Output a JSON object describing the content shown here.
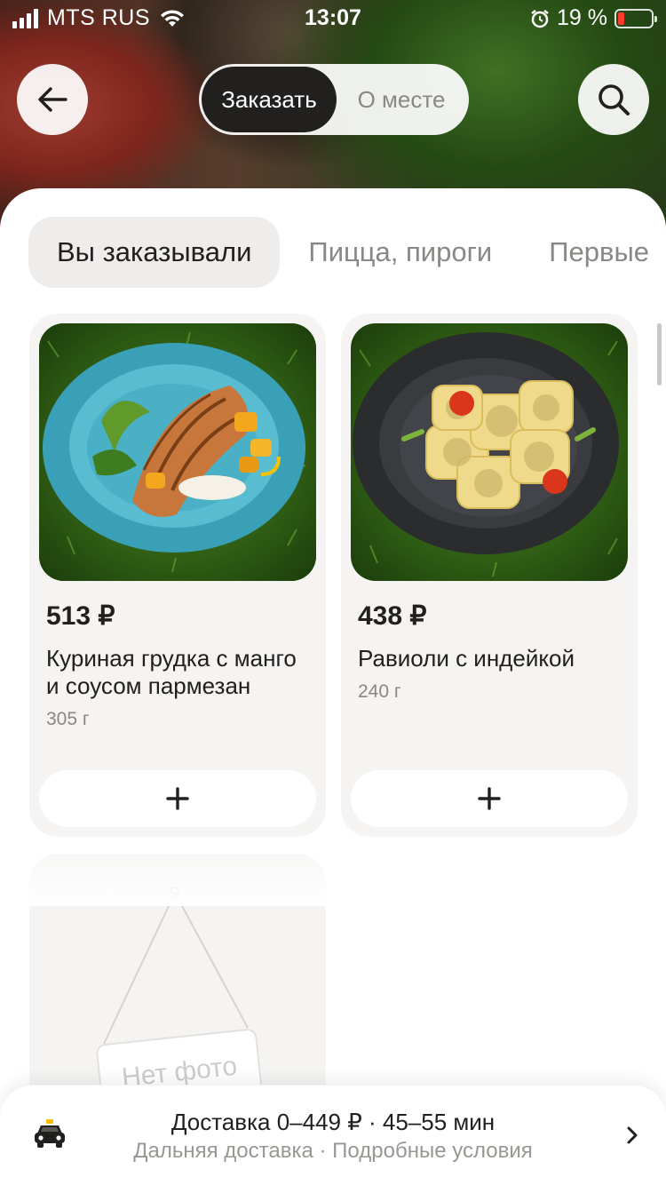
{
  "status_bar": {
    "carrier": "MTS RUS",
    "time": "13:07",
    "battery_percent": "19 %",
    "battery_level": 0.19
  },
  "nav": {
    "back_icon": "arrow-left-icon",
    "search_icon": "search-icon",
    "segments": [
      {
        "label": "Заказать",
        "active": true
      },
      {
        "label": "О месте",
        "active": false
      }
    ]
  },
  "categories": [
    {
      "label": "Вы заказывали",
      "active": true
    },
    {
      "label": "Пицца, пироги",
      "active": false
    },
    {
      "label": "Первые",
      "active": false
    }
  ],
  "products": [
    {
      "price": "513 ₽",
      "title": "Куриная грудка с манго и соусом пармезан",
      "weight": "305 г",
      "add_icon": "plus-icon"
    },
    {
      "price": "438 ₽",
      "title": "Равиоли с индейкой",
      "weight": "240 г",
      "add_icon": "plus-icon"
    }
  ],
  "no_photo": {
    "label": "Нет фото"
  },
  "delivery": {
    "icon": "taxi-icon",
    "main": "Доставка 0–449 ₽ · 45–55 мин",
    "sub": "Дальняя доставка · Подробные условия",
    "chevron": "chevron-right-icon"
  },
  "colors": {
    "accent_dark": "#21201f",
    "chip_bg": "#eeedeb",
    "card_bg": "#f5f4f2",
    "muted_text": "#8a8784"
  }
}
